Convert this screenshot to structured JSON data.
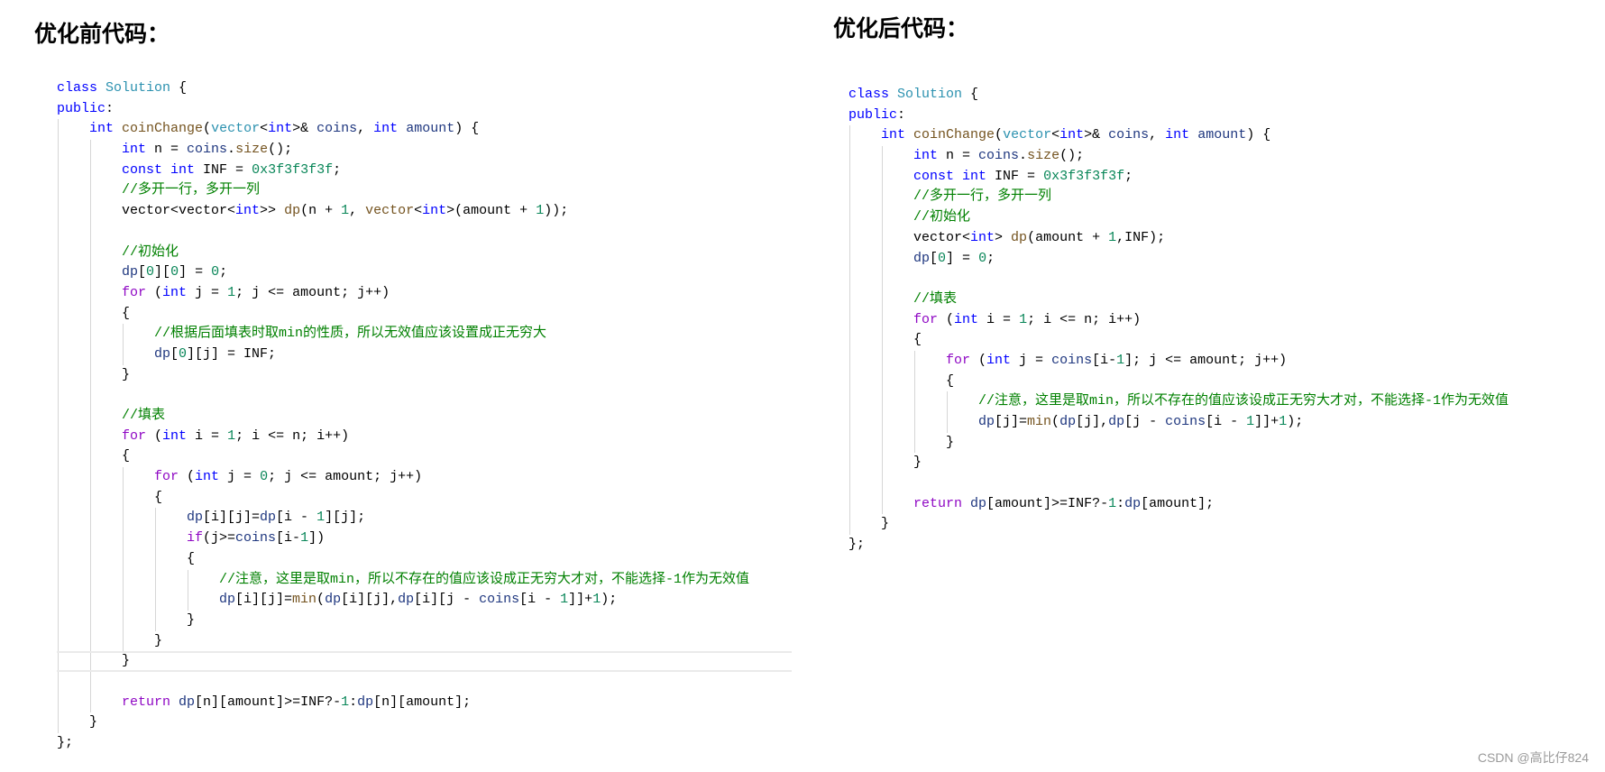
{
  "left": {
    "title": "优化前代码：",
    "lines": [
      {
        "indent": 0,
        "tokens": [
          [
            "k",
            "class"
          ],
          [
            "d",
            " "
          ],
          [
            "t",
            "Solution"
          ],
          [
            "d",
            " {"
          ]
        ]
      },
      {
        "indent": 0,
        "tokens": [
          [
            "k",
            "public"
          ],
          [
            "d",
            ":"
          ]
        ]
      },
      {
        "indent": 1,
        "tokens": [
          [
            "k",
            "int"
          ],
          [
            "d",
            " "
          ],
          [
            "f",
            "coinChange"
          ],
          [
            "d",
            "("
          ],
          [
            "t",
            "vector"
          ],
          [
            "d",
            "<"
          ],
          [
            "k",
            "int"
          ],
          [
            "d",
            ">& "
          ],
          [
            "v",
            "coins"
          ],
          [
            "d",
            ", "
          ],
          [
            "k",
            "int"
          ],
          [
            "d",
            " "
          ],
          [
            "v",
            "amount"
          ],
          [
            "d",
            ") {"
          ]
        ]
      },
      {
        "indent": 2,
        "tokens": [
          [
            "k",
            "int"
          ],
          [
            "d",
            " n = "
          ],
          [
            "v",
            "coins"
          ],
          [
            "d",
            "."
          ],
          [
            "f",
            "size"
          ],
          [
            "d",
            "();"
          ]
        ]
      },
      {
        "indent": 2,
        "tokens": [
          [
            "k",
            "const"
          ],
          [
            "d",
            " "
          ],
          [
            "k",
            "int"
          ],
          [
            "d",
            " INF = "
          ],
          [
            "n",
            "0x3f3f3f3f"
          ],
          [
            "d",
            ";"
          ]
        ]
      },
      {
        "indent": 2,
        "tokens": [
          [
            "c",
            "//多开一行，多开一列"
          ]
        ]
      },
      {
        "indent": 2,
        "tokens": [
          [
            "d",
            "vector<vector<"
          ],
          [
            "k",
            "int"
          ],
          [
            "d",
            ">> "
          ],
          [
            "f",
            "dp"
          ],
          [
            "d",
            "(n + "
          ],
          [
            "n",
            "1"
          ],
          [
            "d",
            ", "
          ],
          [
            "f",
            "vector"
          ],
          [
            "d",
            "<"
          ],
          [
            "k",
            "int"
          ],
          [
            "d",
            ">(amount + "
          ],
          [
            "n",
            "1"
          ],
          [
            "d",
            "));"
          ]
        ]
      },
      {
        "indent": 2,
        "tokens": []
      },
      {
        "indent": 2,
        "tokens": [
          [
            "c",
            "//初始化"
          ]
        ]
      },
      {
        "indent": 2,
        "tokens": [
          [
            "v",
            "dp"
          ],
          [
            "d",
            "["
          ],
          [
            "n",
            "0"
          ],
          [
            "d",
            "]["
          ],
          [
            "n",
            "0"
          ],
          [
            "d",
            "] = "
          ],
          [
            "n",
            "0"
          ],
          [
            "d",
            ";"
          ]
        ]
      },
      {
        "indent": 2,
        "tokens": [
          [
            "p",
            "for"
          ],
          [
            "d",
            " ("
          ],
          [
            "k",
            "int"
          ],
          [
            "d",
            " j = "
          ],
          [
            "n",
            "1"
          ],
          [
            "d",
            "; j <= amount; j++)"
          ]
        ]
      },
      {
        "indent": 2,
        "tokens": [
          [
            "d",
            "{"
          ]
        ]
      },
      {
        "indent": 3,
        "tokens": [
          [
            "c",
            "//根据后面填表时取min的性质，所以无效值应该设置成正无穷大"
          ]
        ]
      },
      {
        "indent": 3,
        "tokens": [
          [
            "v",
            "dp"
          ],
          [
            "d",
            "["
          ],
          [
            "n",
            "0"
          ],
          [
            "d",
            "][j] = INF;"
          ]
        ]
      },
      {
        "indent": 2,
        "tokens": [
          [
            "d",
            "}"
          ]
        ]
      },
      {
        "indent": 2,
        "tokens": []
      },
      {
        "indent": 2,
        "tokens": [
          [
            "c",
            "//填表"
          ]
        ]
      },
      {
        "indent": 2,
        "tokens": [
          [
            "p",
            "for"
          ],
          [
            "d",
            " ("
          ],
          [
            "k",
            "int"
          ],
          [
            "d",
            " i = "
          ],
          [
            "n",
            "1"
          ],
          [
            "d",
            "; i <= n; i++)"
          ]
        ]
      },
      {
        "indent": 2,
        "tokens": [
          [
            "d",
            "{"
          ]
        ]
      },
      {
        "indent": 3,
        "tokens": [
          [
            "p",
            "for"
          ],
          [
            "d",
            " ("
          ],
          [
            "k",
            "int"
          ],
          [
            "d",
            " j = "
          ],
          [
            "n",
            "0"
          ],
          [
            "d",
            "; j <= amount; j++)"
          ]
        ]
      },
      {
        "indent": 3,
        "tokens": [
          [
            "d",
            "{"
          ]
        ]
      },
      {
        "indent": 4,
        "tokens": [
          [
            "v",
            "dp"
          ],
          [
            "d",
            "[i][j]="
          ],
          [
            "v",
            "dp"
          ],
          [
            "d",
            "[i - "
          ],
          [
            "n",
            "1"
          ],
          [
            "d",
            "][j];"
          ]
        ]
      },
      {
        "indent": 4,
        "tokens": [
          [
            "p",
            "if"
          ],
          [
            "d",
            "(j>="
          ],
          [
            "v",
            "coins"
          ],
          [
            "d",
            "[i-"
          ],
          [
            "n",
            "1"
          ],
          [
            "d",
            "])"
          ]
        ]
      },
      {
        "indent": 4,
        "tokens": [
          [
            "d",
            "{"
          ]
        ]
      },
      {
        "indent": 5,
        "tokens": [
          [
            "c",
            "//注意，这里是取min，所以不存在的值应该设成正无穷大才对，不能选择-1作为无效值"
          ]
        ]
      },
      {
        "indent": 5,
        "tokens": [
          [
            "v",
            "dp"
          ],
          [
            "d",
            "[i][j]="
          ],
          [
            "f",
            "min"
          ],
          [
            "d",
            "("
          ],
          [
            "v",
            "dp"
          ],
          [
            "d",
            "[i][j],"
          ],
          [
            "v",
            "dp"
          ],
          [
            "d",
            "[i][j - "
          ],
          [
            "v",
            "coins"
          ],
          [
            "d",
            "[i - "
          ],
          [
            "n",
            "1"
          ],
          [
            "d",
            "]]+"
          ],
          [
            "n",
            "1"
          ],
          [
            "d",
            ");"
          ]
        ]
      },
      {
        "indent": 4,
        "tokens": [
          [
            "d",
            "}"
          ]
        ]
      },
      {
        "indent": 3,
        "tokens": [
          [
            "d",
            "}"
          ]
        ]
      },
      {
        "indent": 2,
        "highlight": true,
        "tokens": [
          [
            "d",
            "}"
          ]
        ]
      },
      {
        "indent": 2,
        "tokens": []
      },
      {
        "indent": 2,
        "tokens": [
          [
            "p",
            "return"
          ],
          [
            "d",
            " "
          ],
          [
            "v",
            "dp"
          ],
          [
            "d",
            "[n][amount]>=INF?-"
          ],
          [
            "n",
            "1"
          ],
          [
            "d",
            ":"
          ],
          [
            "v",
            "dp"
          ],
          [
            "d",
            "[n][amount];"
          ]
        ]
      },
      {
        "indent": 1,
        "tokens": [
          [
            "d",
            "}"
          ]
        ]
      },
      {
        "indent": 0,
        "tokens": [
          [
            "d",
            "};"
          ]
        ]
      }
    ]
  },
  "right": {
    "title": "优化后代码：",
    "lines": [
      {
        "indent": 0,
        "tokens": [
          [
            "k",
            "class"
          ],
          [
            "d",
            " "
          ],
          [
            "t",
            "Solution"
          ],
          [
            "d",
            " {"
          ]
        ]
      },
      {
        "indent": 0,
        "tokens": [
          [
            "k",
            "public"
          ],
          [
            "d",
            ":"
          ]
        ]
      },
      {
        "indent": 1,
        "tokens": [
          [
            "k",
            "int"
          ],
          [
            "d",
            " "
          ],
          [
            "f",
            "coinChange"
          ],
          [
            "d",
            "("
          ],
          [
            "t",
            "vector"
          ],
          [
            "d",
            "<"
          ],
          [
            "k",
            "int"
          ],
          [
            "d",
            ">& "
          ],
          [
            "v",
            "coins"
          ],
          [
            "d",
            ", "
          ],
          [
            "k",
            "int"
          ],
          [
            "d",
            " "
          ],
          [
            "v",
            "amount"
          ],
          [
            "d",
            ") {"
          ]
        ]
      },
      {
        "indent": 2,
        "tokens": [
          [
            "k",
            "int"
          ],
          [
            "d",
            " n = "
          ],
          [
            "v",
            "coins"
          ],
          [
            "d",
            "."
          ],
          [
            "f",
            "size"
          ],
          [
            "d",
            "();"
          ]
        ]
      },
      {
        "indent": 2,
        "tokens": [
          [
            "k",
            "const"
          ],
          [
            "d",
            " "
          ],
          [
            "k",
            "int"
          ],
          [
            "d",
            " INF = "
          ],
          [
            "n",
            "0x3f3f3f3f"
          ],
          [
            "d",
            ";"
          ]
        ]
      },
      {
        "indent": 2,
        "tokens": [
          [
            "c",
            "//多开一行，多开一列"
          ]
        ]
      },
      {
        "indent": 2,
        "tokens": [
          [
            "c",
            "//初始化"
          ]
        ]
      },
      {
        "indent": 2,
        "tokens": [
          [
            "d",
            "vector<"
          ],
          [
            "k",
            "int"
          ],
          [
            "d",
            "> "
          ],
          [
            "f",
            "dp"
          ],
          [
            "d",
            "(amount + "
          ],
          [
            "n",
            "1"
          ],
          [
            "d",
            ",INF);"
          ]
        ]
      },
      {
        "indent": 2,
        "tokens": [
          [
            "v",
            "dp"
          ],
          [
            "d",
            "["
          ],
          [
            "n",
            "0"
          ],
          [
            "d",
            "] = "
          ],
          [
            "n",
            "0"
          ],
          [
            "d",
            ";"
          ]
        ]
      },
      {
        "indent": 2,
        "tokens": []
      },
      {
        "indent": 2,
        "tokens": [
          [
            "c",
            "//填表"
          ]
        ]
      },
      {
        "indent": 2,
        "tokens": [
          [
            "p",
            "for"
          ],
          [
            "d",
            " ("
          ],
          [
            "k",
            "int"
          ],
          [
            "d",
            " i = "
          ],
          [
            "n",
            "1"
          ],
          [
            "d",
            "; i <= n; i++)"
          ]
        ]
      },
      {
        "indent": 2,
        "tokens": [
          [
            "d",
            "{"
          ]
        ]
      },
      {
        "indent": 3,
        "tokens": [
          [
            "p",
            "for"
          ],
          [
            "d",
            " ("
          ],
          [
            "k",
            "int"
          ],
          [
            "d",
            " j = "
          ],
          [
            "v",
            "coins"
          ],
          [
            "d",
            "[i-"
          ],
          [
            "n",
            "1"
          ],
          [
            "d",
            "]; j <= amount; j++)"
          ]
        ]
      },
      {
        "indent": 3,
        "tokens": [
          [
            "d",
            "{"
          ]
        ]
      },
      {
        "indent": 4,
        "tokens": [
          [
            "c",
            "//注意，这里是取min，所以不存在的值应该设成正无穷大才对，不能选择-1作为无效值"
          ]
        ]
      },
      {
        "indent": 4,
        "tokens": [
          [
            "v",
            "dp"
          ],
          [
            "d",
            "[j]="
          ],
          [
            "f",
            "min"
          ],
          [
            "d",
            "("
          ],
          [
            "v",
            "dp"
          ],
          [
            "d",
            "[j],"
          ],
          [
            "v",
            "dp"
          ],
          [
            "d",
            "[j - "
          ],
          [
            "v",
            "coins"
          ],
          [
            "d",
            "[i - "
          ],
          [
            "n",
            "1"
          ],
          [
            "d",
            "]]+"
          ],
          [
            "n",
            "1"
          ],
          [
            "d",
            ");"
          ]
        ]
      },
      {
        "indent": 3,
        "tokens": [
          [
            "d",
            "}"
          ]
        ]
      },
      {
        "indent": 2,
        "tokens": [
          [
            "d",
            "}"
          ]
        ]
      },
      {
        "indent": 2,
        "tokens": []
      },
      {
        "indent": 2,
        "tokens": [
          [
            "p",
            "return"
          ],
          [
            "d",
            " "
          ],
          [
            "v",
            "dp"
          ],
          [
            "d",
            "[amount]>=INF?-"
          ],
          [
            "n",
            "1"
          ],
          [
            "d",
            ":"
          ],
          [
            "v",
            "dp"
          ],
          [
            "d",
            "[amount];"
          ]
        ]
      },
      {
        "indent": 1,
        "tokens": [
          [
            "d",
            "}"
          ]
        ]
      },
      {
        "indent": 0,
        "tokens": [
          [
            "d",
            "};"
          ]
        ]
      }
    ]
  },
  "watermark": "CSDN @高比仔824",
  "colors": {
    "keyword": "#0000ff",
    "type": "#2b91af",
    "function": "#74531f",
    "number": "#098658",
    "comment": "#008000",
    "control": "#8f08c4",
    "variable": "#1f377f"
  }
}
